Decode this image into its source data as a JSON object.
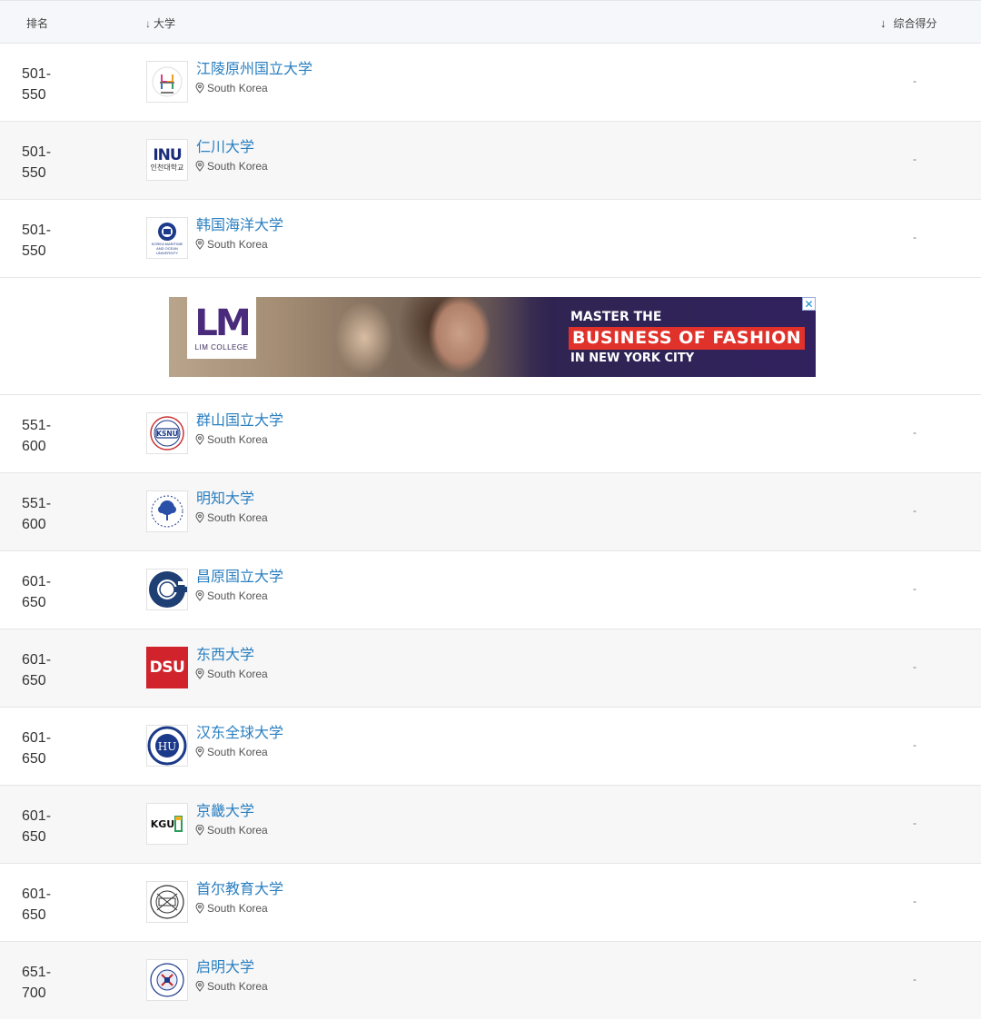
{
  "header": {
    "rank_label": "排名",
    "university_label": "大学",
    "score_label": "综合得分",
    "sort_icon": "arrow-down-icon"
  },
  "ad": {
    "brand": "LM",
    "brand_sub": "LIM COLLEGE",
    "line1": "MASTER THE",
    "line2": "BUSINESS OF FASHION",
    "line3": "IN NEW YORK CITY",
    "close": "✕"
  },
  "rows": [
    {
      "rank_top": "501-",
      "rank_bottom": "550",
      "name": "江陵原州国立大学",
      "location": "South Korea",
      "score": "-",
      "logo": "gangneung-wonju-logo"
    },
    {
      "rank_top": "501-",
      "rank_bottom": "550",
      "name": "仁川大学",
      "location": "South Korea",
      "score": "-",
      "logo": "incheon-logo"
    },
    {
      "rank_top": "501-",
      "rank_bottom": "550",
      "name": "韩国海洋大学",
      "location": "South Korea",
      "score": "-",
      "logo": "kmou-logo"
    },
    {
      "rank_top": "551-",
      "rank_bottom": "600",
      "name": "群山国立大学",
      "location": "South Korea",
      "score": "-",
      "logo": "ksnu-logo"
    },
    {
      "rank_top": "551-",
      "rank_bottom": "600",
      "name": "明知大学",
      "location": "South Korea",
      "score": "-",
      "logo": "myongji-logo"
    },
    {
      "rank_top": "601-",
      "rank_bottom": "650",
      "name": "昌原国立大学",
      "location": "South Korea",
      "score": "-",
      "logo": "changwon-logo"
    },
    {
      "rank_top": "601-",
      "rank_bottom": "650",
      "name": "东西大学",
      "location": "South Korea",
      "score": "-",
      "logo": "dsu-logo"
    },
    {
      "rank_top": "601-",
      "rank_bottom": "650",
      "name": "汉东全球大学",
      "location": "South Korea",
      "score": "-",
      "logo": "handong-logo"
    },
    {
      "rank_top": "601-",
      "rank_bottom": "650",
      "name": "京畿大学",
      "location": "South Korea",
      "score": "-",
      "logo": "kgu-logo"
    },
    {
      "rank_top": "601-",
      "rank_bottom": "650",
      "name": "首尔教育大学",
      "location": "South Korea",
      "score": "-",
      "logo": "snue-logo"
    },
    {
      "rank_top": "651-",
      "rank_bottom": "700",
      "name": "启明大学",
      "location": "South Korea",
      "score": "-",
      "logo": "keimyung-logo"
    }
  ],
  "logo_texts": {
    "incheon_top": "INU",
    "incheon_bottom": "인천대학교",
    "kmou": "KOREA MARITIME AND OCEAN UNIVERSITY",
    "ksnu": "KSNU",
    "dsu": "DSU",
    "handong": "HU",
    "kgu": "KGU"
  },
  "colors": {
    "link": "#2a7fc0",
    "ad_red": "#e0322b",
    "ad_purple": "#31225f"
  }
}
